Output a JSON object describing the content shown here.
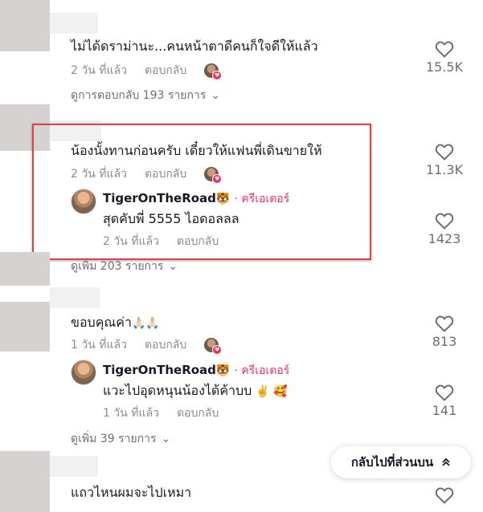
{
  "comments": [
    {
      "text": "ไม่ได้ดราม่านะ...คนหน้าตาดีคนก็ใจดีให้แล้ว",
      "time": "2 วัน ที่แล้ว",
      "reply_label": "ตอบกลับ",
      "likes": "15.5K",
      "view_replies": "ดูการตอบกลับ 193 รายการ"
    },
    {
      "text": "น้องนั้งทานก่อนครับ เดี๋ยวให้แฟนพี่เดินขายให้",
      "time": "2 วัน ที่แล้ว",
      "reply_label": "ตอบกลับ",
      "likes": "11.3K",
      "reply": {
        "author": "TigerOnTheRoad",
        "author_emoji": "🐯",
        "badge": "· ครีเอเตอร์",
        "text": "สุดคับพี่ 5555 ไอดอลลล",
        "time": "2 วัน ที่แล้ว",
        "reply_label": "ตอบกลับ",
        "likes": "1423"
      },
      "view_more": "ดูเพิ่ม 203 รายการ"
    },
    {
      "text": "ขอบคุณค่า",
      "emoji": "🙏🏻🙏🏻",
      "time": "1 วัน ที่แล้ว",
      "reply_label": "ตอบกลับ",
      "likes": "813",
      "reply": {
        "author": "TigerOnTheRoad",
        "author_emoji": "🐯",
        "badge": "· ครีเอเตอร์",
        "text": "แวะไปอุดหนุนน้องได้ค้าบบ",
        "emoji": "✌️ 🥰",
        "time": "1 วัน ที่แล้ว",
        "reply_label": "ตอบกลับ",
        "likes": "141"
      },
      "view_more": "ดูเพิ่ม 39 รายการ"
    },
    {
      "text": "แถวไหนผมจะไปเหมา"
    }
  ],
  "back_to_top": "กลับไปที่ส่วนบน",
  "colors": {
    "accent": "#fe2c55",
    "highlight": "#e0433f",
    "muted": "#8a8b91"
  }
}
